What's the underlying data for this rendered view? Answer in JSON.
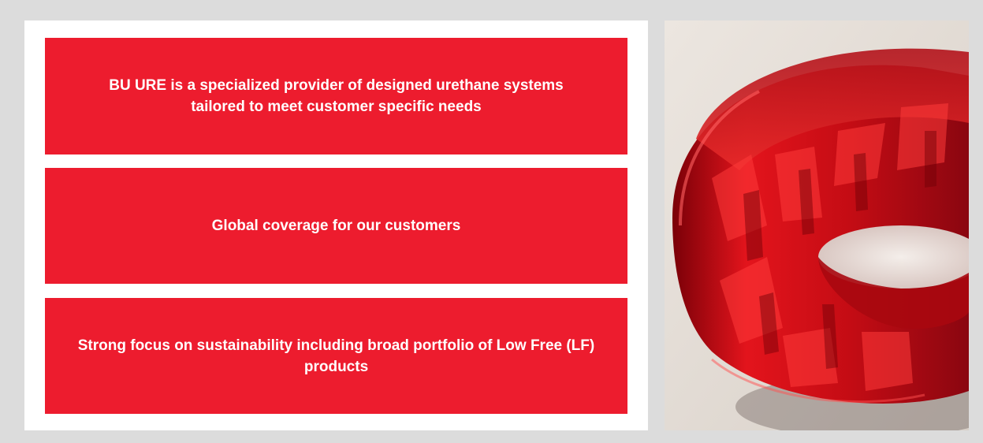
{
  "cards": [
    {
      "text": "BU URE is a specialized provider of designed urethane systems tailored to meet customer specific needs"
    },
    {
      "text": "Global coverage for our customers"
    },
    {
      "text": "Strong focus on sustainability including broad portfolio of Low Free (LF) products"
    }
  ],
  "colors": {
    "background": "#dcdcdc",
    "card_red": "#ed1c2e",
    "panel": "#ffffff",
    "text": "#ffffff"
  },
  "image": {
    "icon": "red-urethane-wheel-photo"
  }
}
